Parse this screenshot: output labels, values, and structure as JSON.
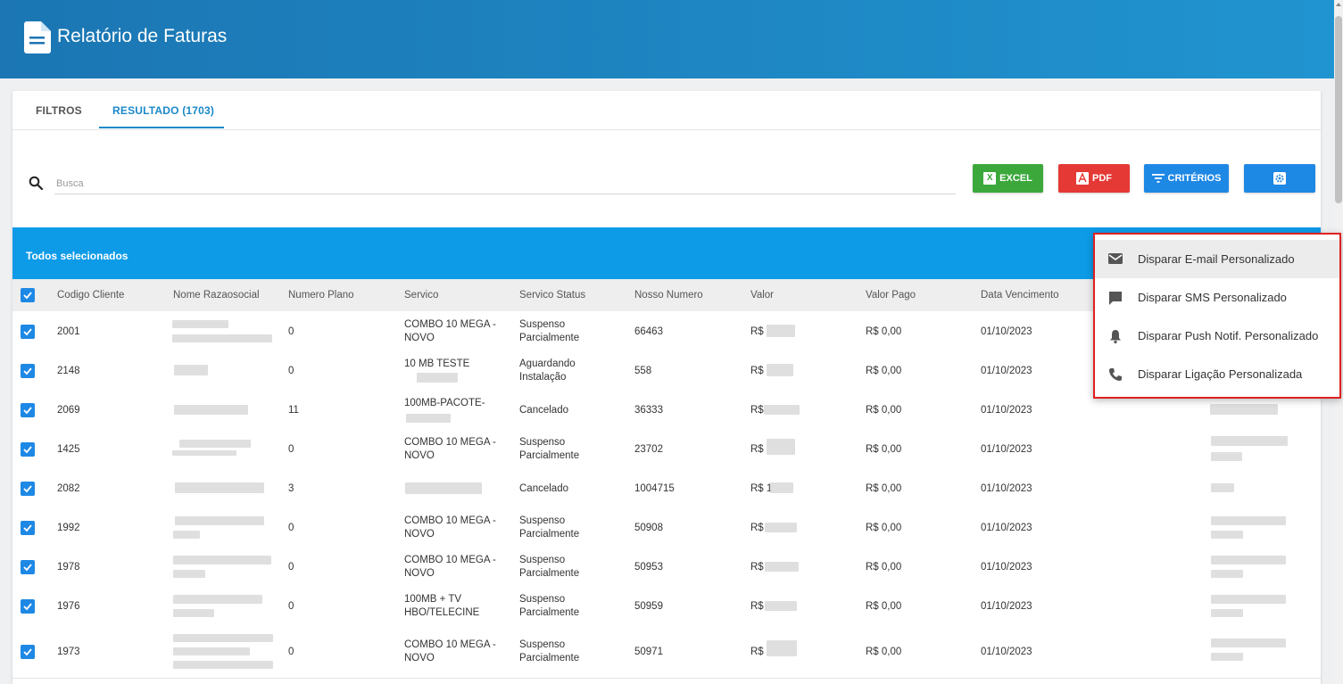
{
  "header": {
    "title": "Relatório de Faturas"
  },
  "tabs": [
    {
      "label": "FILTROS"
    },
    {
      "label": "RESULTADO (1703)"
    }
  ],
  "search": {
    "placeholder": "Busca",
    "value": ""
  },
  "toolbar": {
    "excel_label": "EXCEL",
    "pdf_label": "PDF",
    "criterios_label": "CRITÉRIOS"
  },
  "selection": {
    "label": "Todos selecionados"
  },
  "columns": [
    "Codigo Cliente",
    "Nome Razaosocial",
    "Numero Plano",
    "Servico",
    "Servico Status",
    "Nosso Numero",
    "Valor",
    "Valor Pago",
    "Data Vencimento"
  ],
  "rows": [
    {
      "codigo": "2001",
      "plano": "0",
      "servico": [
        "COMBO 10 MEGA -",
        "NOVO"
      ],
      "status": [
        "Suspenso",
        "Parcialmente"
      ],
      "nosso": "66463",
      "valor": "R$",
      "pago": "R$ 0,00",
      "venc": "01/10/2023"
    },
    {
      "codigo": "2148",
      "plano": "0",
      "servico": [
        "10 MB TESTE",
        ""
      ],
      "status": [
        "Aguardando",
        "Instalação"
      ],
      "nosso": "558",
      "valor": "R$",
      "pago": "R$ 0,00",
      "venc": "01/10/2023"
    },
    {
      "codigo": "2069",
      "plano": "11",
      "servico": [
        "100MB-PACOTE-",
        ""
      ],
      "status": [
        "Cancelado"
      ],
      "nosso": "36333",
      "valor": "R$",
      "pago": "R$ 0,00",
      "venc": "01/10/2023"
    },
    {
      "codigo": "1425",
      "plano": "0",
      "servico": [
        "COMBO 10 MEGA -",
        "NOVO"
      ],
      "status": [
        "Suspenso",
        "Parcialmente"
      ],
      "nosso": "23702",
      "valor": "R$",
      "pago": "R$ 0,00",
      "venc": "01/10/2023"
    },
    {
      "codigo": "2082",
      "plano": "3",
      "servico": [
        ""
      ],
      "status": [
        "Cancelado"
      ],
      "nosso": "1004715",
      "valor": "R$ 1",
      "pago": "R$ 0,00",
      "venc": "01/10/2023"
    },
    {
      "codigo": "1992",
      "plano": "0",
      "servico": [
        "COMBO 10 MEGA -",
        "NOVO"
      ],
      "status": [
        "Suspenso",
        "Parcialmente"
      ],
      "nosso": "50908",
      "valor": "R$",
      "pago": "R$ 0,00",
      "venc": "01/10/2023"
    },
    {
      "codigo": "1978",
      "plano": "0",
      "servico": [
        "COMBO 10 MEGA -",
        "NOVO"
      ],
      "status": [
        "Suspenso",
        "Parcialmente"
      ],
      "nosso": "50953",
      "valor": "R$",
      "pago": "R$ 0,00",
      "venc": "01/10/2023"
    },
    {
      "codigo": "1976",
      "plano": "0",
      "servico": [
        "100MB + TV",
        "HBO/TELECINE"
      ],
      "status": [
        "Suspenso",
        "Parcialmente"
      ],
      "nosso": "50959",
      "valor": "R$",
      "pago": "R$ 0,00",
      "venc": "01/10/2023"
    },
    {
      "codigo": "1973",
      "plano": "0",
      "servico": [
        "COMBO 10 MEGA -",
        "NOVO"
      ],
      "status": [
        "Suspenso",
        "Parcialmente"
      ],
      "nosso": "50971",
      "valor": "R$",
      "pago": "R$ 0,00",
      "venc": "01/10/2023"
    }
  ],
  "menu": {
    "items": [
      {
        "label": "Disparar E-mail Personalizado",
        "icon": "email-icon"
      },
      {
        "label": "Disparar SMS Personalizado",
        "icon": "chat-icon"
      },
      {
        "label": "Disparar Push Notif. Personalizado",
        "icon": "bell-icon"
      },
      {
        "label": "Disparar Ligação Personalizada",
        "icon": "phone-icon"
      }
    ]
  },
  "colors": {
    "header": "#1b76b3",
    "accent": "#1a88c9",
    "selection_bar": "#0d9be8",
    "excel": "#3ca83c",
    "pdf": "#e53935",
    "primary_button": "#1e88e5",
    "highlight_border": "#e02020"
  }
}
